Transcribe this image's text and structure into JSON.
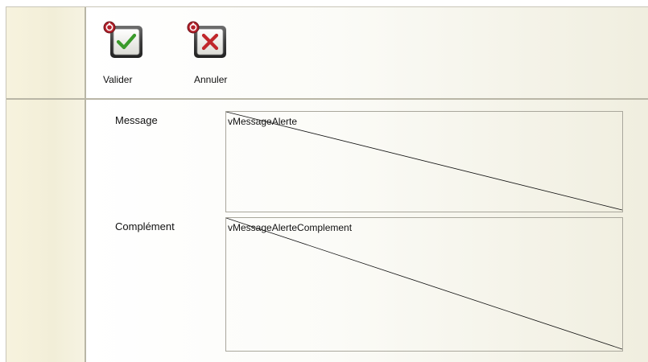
{
  "toolbar": {
    "valider_label": "Valider",
    "annuler_label": "Annuler",
    "valider_icon": "checkmark-icon",
    "annuler_icon": "x-icon",
    "badge_icon": "red-badge-icon"
  },
  "fields": {
    "message": {
      "label": "Message",
      "value": "vMessageAlerte"
    },
    "complement": {
      "label": "Complément",
      "value": "vMessageAlerteComplement"
    }
  },
  "colors": {
    "accept_green": "#3a9a2b",
    "cancel_red": "#c0262b",
    "badge_red": "#b3212b",
    "panel_beige": "#f2eed8",
    "divider": "#b9b6a6"
  }
}
